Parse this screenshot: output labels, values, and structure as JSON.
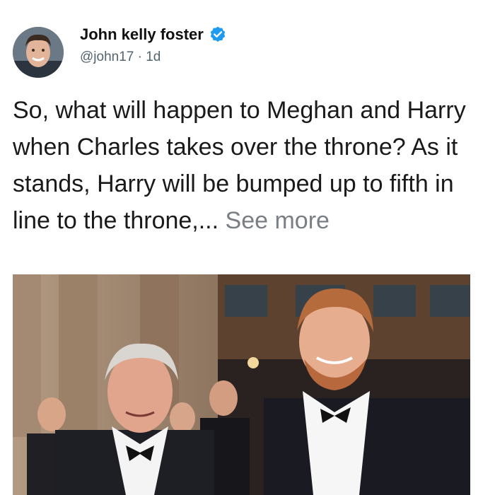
{
  "post": {
    "author_name": "John kelly foster",
    "handle": "@john17",
    "separator": " · ",
    "time": "1d",
    "text": "So, what will happen to Meghan and Harry when Charles takes over the throne? As it stands, Harry will be bumped up to fifth in line to the throne,... ",
    "see_more": "See more"
  },
  "icons": {
    "avatar": "profile-photo",
    "verified": "verified-badge-icon"
  },
  "colors": {
    "verified": "#1d9bf0",
    "see_more": "#7a7f85",
    "handle": "#536471"
  }
}
